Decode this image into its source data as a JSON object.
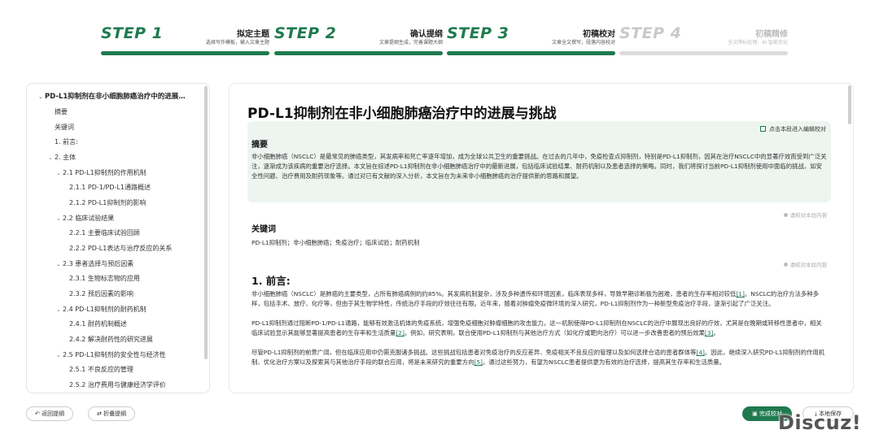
{
  "steps": [
    {
      "num": "STEP 1",
      "name": "拟定主题",
      "desc": "选择写作模板，输入文章主题",
      "active": true
    },
    {
      "num": "STEP 2",
      "name": "确认提纲",
      "desc": "文章提纲生成，完善课题大纲",
      "active": true
    },
    {
      "num": "STEP 3",
      "name": "初稿校对",
      "desc": "文章全文撰写，段落内容校对",
      "active": true
    },
    {
      "num": "STEP 4",
      "name": "初稿精修",
      "desc": "全文降标处理、AI 智能优化",
      "active": false
    }
  ],
  "outline": {
    "items": [
      "PD-L1抑制剂在非小细胞肺癌治疗中的进展…",
      "摘要",
      "关键词",
      "1. 前言:",
      "2. 主体",
      "2.1 PD-L1抑制剂的作用机制",
      "2.1.1 PD-1/PD-L1通路概述",
      "2.1.2 PD-L1抑制剂的影响",
      "2.2 临床试验结果",
      "2.2.1 主要临床试验回顾",
      "2.2.2 PD-L1表达与治疗反应的关系",
      "2.3 患者选择与预后因素",
      "2.3.1 生物标志物的应用",
      "2.3.2 预后因素的影响",
      "2.4 PD-L1抑制剂的耐药机制",
      "2.4.1 耐药机制概述",
      "2.4.2 解决耐药性的研究进展",
      "2.5 PD-L1抑制剂的安全性与经济性",
      "2.5.1 不良反应的管理",
      "2.5.2 治疗费用与健康经济学评价"
    ]
  },
  "document": {
    "title": "PD-L1抑制剂在非小细胞肺癌治疗中的进展与挑战",
    "abstract_heading": "摘要",
    "abstract_link": "点击本段进入编辑校对",
    "abstract_text": "非小细胞肺癌（NSCLC）是最常见的肺癌类型，其发病率和死亡率逐年增加，成为全球公共卫生的重要挑战。在过去的几年中，免疫检查点抑制剂，特别是PD-L1抑制剂，因其在治疗NSCLC中的显著疗效而受到广泛关注，逐渐成为该疾病的重要治疗选择。本文旨在综述PD-L1抑制剂在非小细胞肺癌治疗中的最新进展，包括临床试验结果、耐药机制以及患者选择的策略。同时，我们将探讨当前PD-L1抑制剂使用中面临的挑战，如安全性问题、治疗费用及耐药现象等。通过对已有文献的深入分析，本文旨在为未来非小细胞肺癌的治疗提供新的思路和展望。",
    "hint1": "请校对本段内容",
    "keywords_heading": "关键词",
    "keywords_text": "PD-L1抑制剂；非小细胞肺癌；免疫治疗；临床试验；耐药机制",
    "hint2": "请校对本段内容",
    "intro_heading": "1. 前言:",
    "intro_p1_a": "非小细胞肺癌（NSCLC）是肺癌的主要类型，占所有肺癌病例的约85%。其发病机制复杂，涉及多种遗传和环境因素，临床表现多样，导致早期诊断极为困难，患者的生存率相对较低",
    "ref1": "[1]",
    "intro_p1_b": "。NSCLC的治疗方法多种多样，包括手术、放疗、化疗等，但由于其生物学特性，传统治疗手段的疗效往往有限。近年来，随着对肿瘤免疫微环境的深入研究，PD-L1抑制剂作为一种新型免疫治疗手段，逐渐引起了广泛关注。",
    "intro_p2_a": "PD-L1抑制剂通过阻断PD-1/PD-L1通路，能够有效激活机体的免疫系统，增强免疫细胞对肿瘤细胞的攻击能力。这一机制使得PD-L1抑制剂在NSCLC的治疗中展现出良好的疗效，尤其是在晚期或转移性患者中，相关临床试验显示其能够显著提高患者的生存率和生活质量",
    "ref2": "[2]",
    "intro_p2_b": "。例如，研究表明，联合使用PD-L1抑制剂与其他治疗方式（如化疗或靶向治疗）可以进一步改善患者的预后效果",
    "ref3": "[3]",
    "intro_p2_c": "。",
    "intro_p3_a": "尽管PD-L1抑制剂的前景广阔，但在临床应用中仍需克服诸多挑战。这些挑战包括患者对免疫治疗的反应差异、免疫相关不良反应的管理以及如何选择合适的患者群体等",
    "ref4": "[4]",
    "intro_p3_b": "。因此，继续深入研究PD-L1抑制剂的作用机制、优化治疗方案以及探索其与其他治疗手段的联合应用，将是未来研究的重要方向",
    "ref5": "[5]",
    "intro_p3_c": "。通过这些努力，有望为NSCLC患者提供更为有效的治疗选择，提高其生存率和生活质量。"
  },
  "bottom": {
    "back_label": "返回提纲",
    "collapse_label": "折叠提纲",
    "finish_label": "完成校对",
    "save_label": "本地保存",
    "watermark": "Discuz!"
  },
  "colors": {
    "accent": "#1f7a4f",
    "abstract_bg": "#eef5f0",
    "inactive": "#dcdcdc"
  }
}
